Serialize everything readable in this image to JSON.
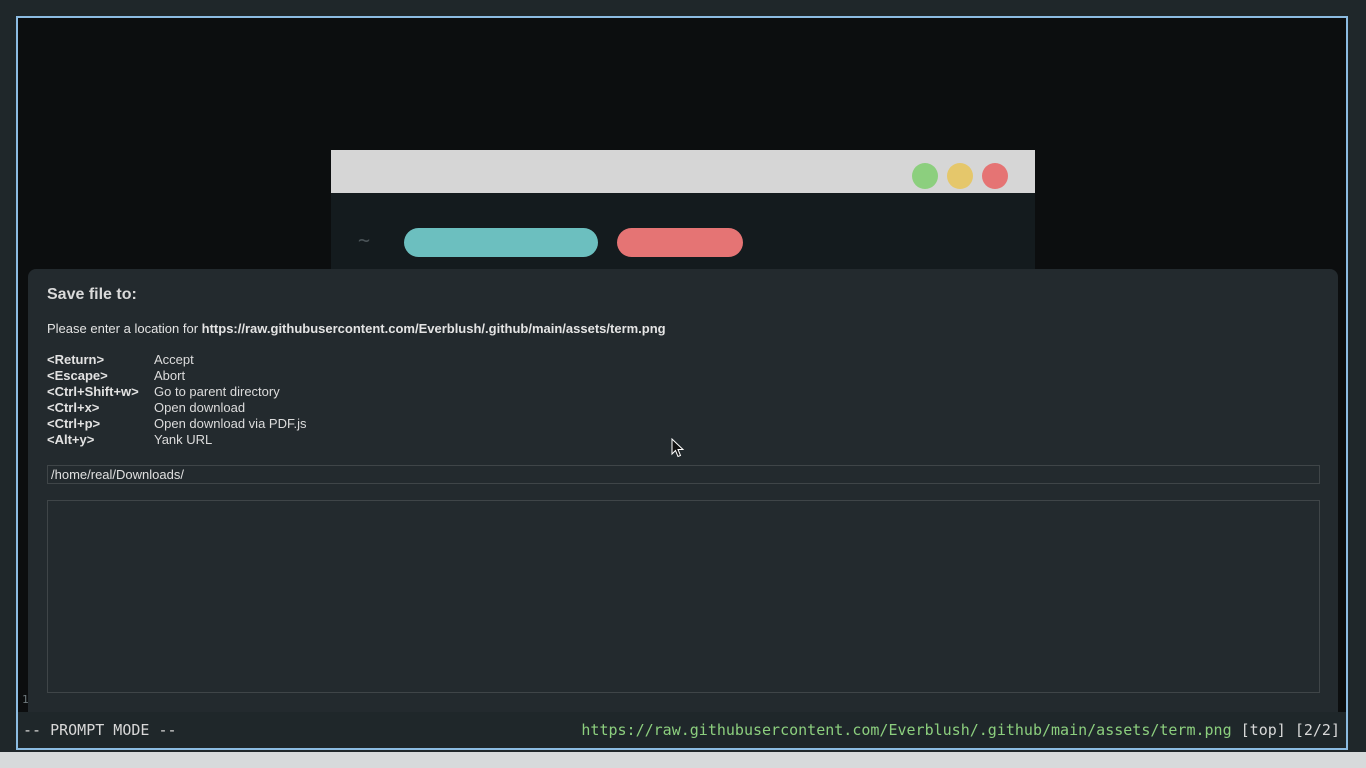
{
  "colors": {
    "window_border": "#8cbce2",
    "dot_green": "#8ccf7e",
    "dot_yellow": "#e5c76b",
    "dot_red": "#e57474",
    "pill_teal": "#6cbfbf",
    "pill_red": "#e57474",
    "url_green": "#8ccf7e"
  },
  "page_image": {
    "prompt_symbol": "~"
  },
  "prompt": {
    "title": "Save file to:",
    "message_prefix": "Please enter a location for ",
    "message_url": "https://raw.githubusercontent.com/Everblush/.github/main/assets/term.png",
    "keys": [
      {
        "key": "<Return>",
        "action": "Accept"
      },
      {
        "key": "<Escape>",
        "action": "Abort"
      },
      {
        "key": "<Ctrl+Shift+w>",
        "action": "Go to parent directory"
      },
      {
        "key": "<Ctrl+x>",
        "action": "Open download"
      },
      {
        "key": "<Ctrl+p>",
        "action": "Open download via PDF.js"
      },
      {
        "key": "<Alt+y>",
        "action": "Yank URL"
      }
    ],
    "input_value": "/home/real/Downloads/"
  },
  "gutter_text": "1",
  "statusbar": {
    "mode": "-- PROMPT MODE --",
    "url": "https://raw.githubusercontent.com/Everblush/.github/main/assets/term.png",
    "scroll": "[top]",
    "tabs": "[2/2]"
  },
  "icons": {
    "cursor": "mouse-pointer-icon"
  }
}
